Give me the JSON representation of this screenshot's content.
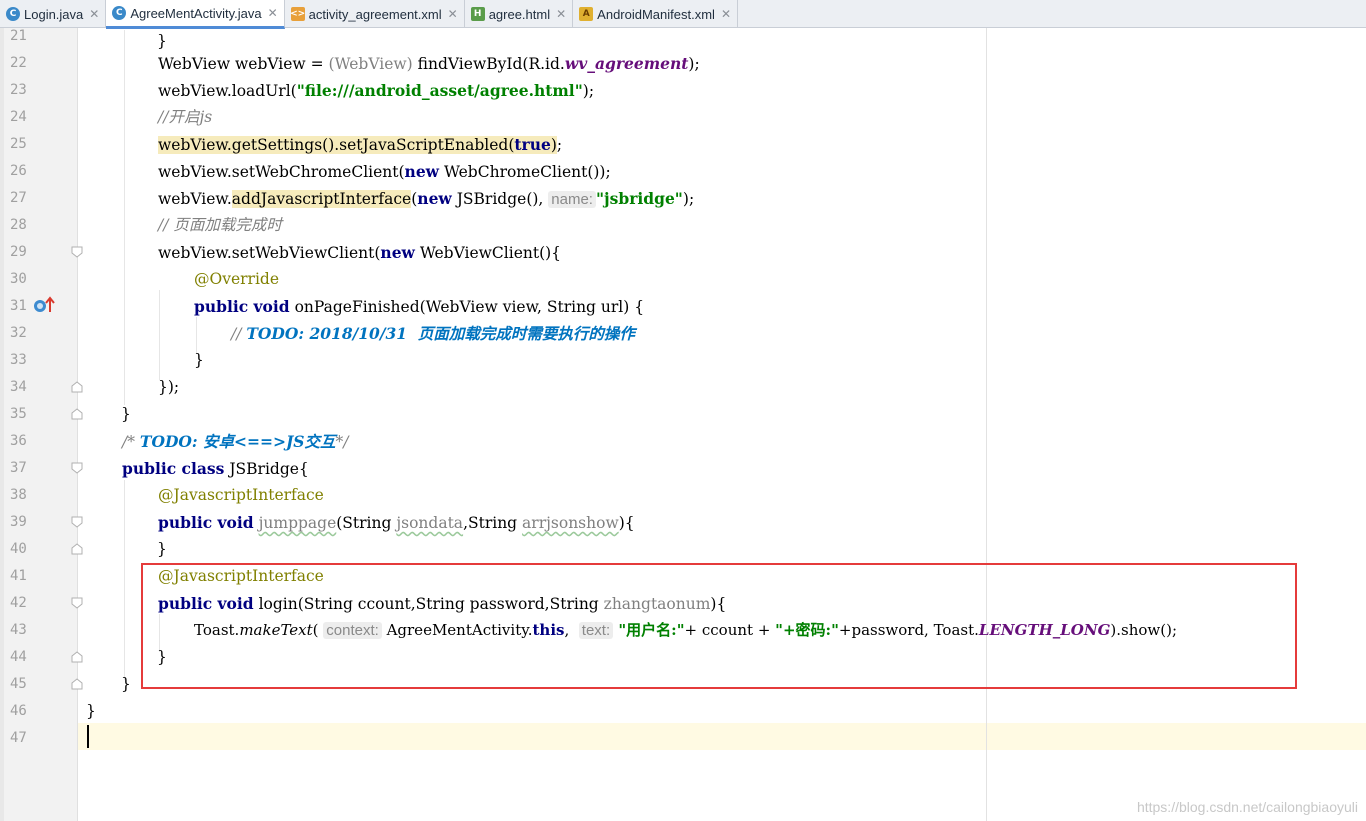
{
  "tabs": [
    {
      "label": "Login.java",
      "type": "java",
      "active": false
    },
    {
      "label": "AgreeMentActivity.java",
      "type": "java",
      "active": true
    },
    {
      "label": "activity_agreement.xml",
      "type": "xml",
      "active": false
    },
    {
      "label": "agree.html",
      "type": "html",
      "active": false
    },
    {
      "label": "AndroidManifest.xml",
      "type": "manifest",
      "active": false
    }
  ],
  "line_numbers": [
    "21",
    "22",
    "23",
    "24",
    "25",
    "26",
    "27",
    "28",
    "29",
    "30",
    "31",
    "32",
    "33",
    "34",
    "35",
    "36",
    "37",
    "38",
    "39",
    "40",
    "41",
    "42",
    "43",
    "44",
    "45",
    "46",
    "47"
  ],
  "current_line": "47",
  "code": {
    "l21": "}",
    "l22a": "WebView webView = ",
    "l22b": "(WebView)",
    "l22c": " findViewById(R.id.",
    "l22d": "wv_agreement",
    "l22e": ");",
    "l23a": "webView.loadUrl(",
    "l23b": "\"file:///android_asset/agree.html\"",
    "l23c": ");",
    "l24": "//开启js",
    "l25a": "webView.getSettings().setJavaScriptEnabled(",
    "l25b": "true",
    "l25c": ")",
    "l25d": ";",
    "l26a": "webView.setWebChromeClient(",
    "l26b": "new",
    "l26c": " WebChromeClient());",
    "l27a": "webView.",
    "l27b": "addJavascriptInterface",
    "l27c": "(",
    "l27d": "new",
    "l27e": " JSBridge(), ",
    "l27hint": "name:",
    "l27f": "\"jsbridge\"",
    "l27g": ");",
    "l28": "// 页面加载完成时",
    "l29a": "webView.setWebViewClient(",
    "l29b": "new",
    "l29c": " WebViewClient(){",
    "l30": "@Override",
    "l31a": "public void",
    "l31b": " onPageFinished(WebView view, String url) {",
    "l32a": "// ",
    "l32b": "TODO: 2018/10/31  页面加载完成时需要执行的操作",
    "l33": "}",
    "l34": "});",
    "l35": "}",
    "l36a": "/* ",
    "l36b": "TODO: 安卓<==>JS交互",
    "l36c": "*/",
    "l37a": "public class",
    "l37b": " JSBridge{",
    "l38": "@JavascriptInterface",
    "l39a": "public void",
    "l39b": " ",
    "l39c": "jumppage",
    "l39d": "(String ",
    "l39e": "jsondata",
    "l39f": ",String ",
    "l39g": "arrjsonshow",
    "l39h": "){",
    "l40": "}",
    "l41": "@JavascriptInterface",
    "l42a": "public void",
    "l42b": " login(String ccount,String password,String ",
    "l42c": "zhangtaonum",
    "l42d": "){",
    "l43a": "Toast.",
    "l43b": "makeText",
    "l43c": "( ",
    "l43hint1": "context:",
    "l43d": " AgreeMentActivity.",
    "l43e": "this",
    "l43f": ",  ",
    "l43hint2": "text:",
    "l43g": " \"用户名:\"",
    "l43h": "+ ccount + ",
    "l43i": "\"+密码:\"",
    "l43j": "+password, Toast.",
    "l43k": "LENGTH_LONG",
    "l43l": ").show();",
    "l44": "}",
    "l45": "}",
    "l46": "}"
  },
  "watermark": "https://blog.csdn.net/cailongbiaoyuli",
  "colors": {
    "keyword": "#000080",
    "string": "#008000",
    "comment": "#808080",
    "todo": "#0073bf",
    "annotation": "#808000",
    "highlight_box": "#e53b3b"
  }
}
